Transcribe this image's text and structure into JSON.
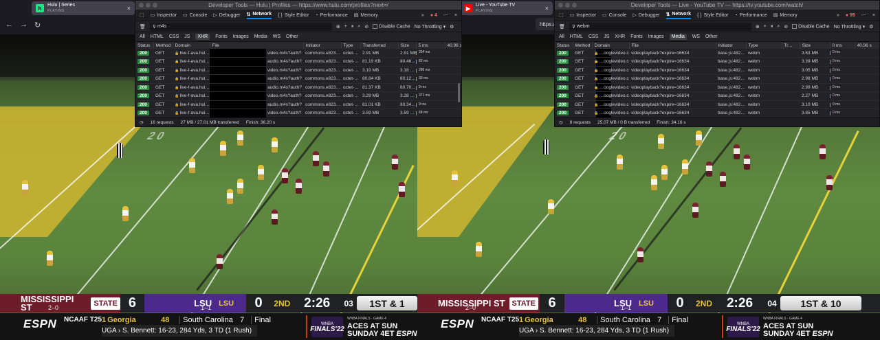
{
  "left": {
    "tab": {
      "title": "Hulu | Series",
      "status": "PLAYING",
      "favicon": "h"
    },
    "devtools": {
      "title": "Developer Tools — Hulu | Profiles — https://www.hulu.com/profiles?next=/",
      "tools": [
        "Inspector",
        "Console",
        "Debugger",
        "Network",
        "Style Editor",
        "Performance",
        "Memory"
      ],
      "error_count": "4",
      "filter_text": "m4s",
      "disable_cache_label": "Disable Cache",
      "throttling_label": "No Throttling",
      "types": [
        "All",
        "HTML",
        "CSS",
        "JS",
        "XHR",
        "Fonts",
        "Images",
        "Media",
        "WS",
        "Other"
      ],
      "active_type": "XHR",
      "columns": [
        "Status",
        "Method",
        "Domain",
        "File",
        "Initiator",
        "Type",
        "Transferred",
        "Size",
        "5 ms",
        "40.96 s"
      ],
      "rows": [
        {
          "status": "200",
          "method": "GET",
          "domain": "live-f-ava.hul…",
          "file": "video.m4s?auth?",
          "initiator": "commons.e823…",
          "type": "octet-…",
          "transferred": "2.91 MB",
          "size": "2.91 MB",
          "wf": "254 ms"
        },
        {
          "status": "200",
          "method": "GET",
          "domain": "live-f-ava.hul…",
          "file": "audio.m4s?auth?",
          "initiator": "commons.e823…",
          "type": "octet-…",
          "transferred": "81.19 KB",
          "size": "80.46…",
          "wf": "82 ms"
        },
        {
          "status": "200",
          "method": "GET",
          "domain": "live-f-ava.hul…",
          "file": "video.m4s?auth?",
          "initiator": "commons.e823…",
          "type": "octet-…",
          "transferred": "3.19 MB",
          "size": "3.18 …",
          "wf": "286 ms"
        },
        {
          "status": "200",
          "method": "GET",
          "domain": "live-f-ava.hul…",
          "file": "audio.m4s?auth?",
          "initiator": "commons.e823…",
          "type": "octet-…",
          "transferred": "80.84 KB",
          "size": "80.12…",
          "wf": "30 ms"
        },
        {
          "status": "200",
          "method": "GET",
          "domain": "live-f-ava.hul…",
          "file": "audio.m4s?auth?",
          "initiator": "commons.e823…",
          "type": "octet-…",
          "transferred": "81.37 KB",
          "size": "80.70…",
          "wf": "9 ms"
        },
        {
          "status": "200",
          "method": "GET",
          "domain": "live-f-ava.hul…",
          "file": "video.m4s?auth?",
          "initiator": "commons.e823…",
          "type": "octet-…",
          "transferred": "3.29 MB",
          "size": "3.28 …",
          "wf": "371 ms"
        },
        {
          "status": "200",
          "method": "GET",
          "domain": "live-f-ava.hul…",
          "file": "audio.m4s?auth?",
          "initiator": "commons.e823…",
          "type": "octet-…",
          "transferred": "81.01 KB",
          "size": "80.34…",
          "wf": "9 ms"
        },
        {
          "status": "200",
          "method": "GET",
          "domain": "live-f-ava.hul…",
          "file": "video.m4s?auth?",
          "initiator": "commons.e823…",
          "type": "octet-…",
          "transferred": "3.59 MB",
          "size": "3.59 …",
          "wf": "68 ms"
        }
      ],
      "footer": {
        "requests": "16 requests",
        "transferred": "27 MB / 27.01 MB transferred",
        "finish": "Finish: 36.20 s"
      }
    },
    "scorebug": {
      "team1": "MISSISSIPPI ST",
      "team1_record": "2–0",
      "team1_logo": "STATE",
      "team1_score": "6",
      "team2": "LSU",
      "team2_record": "1–1",
      "team2_logo": "LSU",
      "team2_score": "0",
      "quarter": "2ND",
      "clock": "2:26",
      "play_clock": "03",
      "down": "1ST & 1"
    }
  },
  "right": {
    "tab": {
      "title": "Live - YouTube TV",
      "status": "PLAYING",
      "favicon": "▶"
    },
    "url": "https://tv.youtube.com/watch",
    "devtools": {
      "title": "Developer Tools — Live - YouTube TV — https://tv.youtube.com/watch/",
      "tools": [
        "Inspector",
        "Console",
        "Debugger",
        "Network",
        "Style Editor",
        "Performance",
        "Memory"
      ],
      "error_count": "95",
      "filter_text": "webm",
      "disable_cache_label": "Disable Cache",
      "throttling_label": "No Throttling",
      "types": [
        "All",
        "HTML",
        "CSS",
        "JS",
        "XHR",
        "Fonts",
        "Images",
        "Media",
        "WS",
        "Other"
      ],
      "active_type": "Media",
      "columns": [
        "Status",
        "Method",
        "Domain",
        "File",
        "Initiator",
        "Type",
        "Tr…",
        "Size",
        "0 ms",
        "40.96 s"
      ],
      "rows": [
        {
          "status": "200",
          "method": "GET",
          "domain": "…ooglevideo.com",
          "file": "videoplayback?expire=16634",
          "initiator": "base.js:482…",
          "type": "webm",
          "transferred": "",
          "size": "3.63 MB",
          "wf": "0 ms"
        },
        {
          "status": "200",
          "method": "GET",
          "domain": "…ooglevideo.com",
          "file": "videoplayback?expire=16634",
          "initiator": "base.js:482…",
          "type": "webm",
          "transferred": "",
          "size": "3.39 MB",
          "wf": "0 ms"
        },
        {
          "status": "200",
          "method": "GET",
          "domain": "…ooglevideo.com",
          "file": "videoplayback?expire=16634",
          "initiator": "base.js:482…",
          "type": "webm",
          "transferred": "",
          "size": "3.05 MB",
          "wf": "0 ms"
        },
        {
          "status": "200",
          "method": "GET",
          "domain": "…ooglevideo.com",
          "file": "videoplayback?expire=16634",
          "initiator": "base.js:482…",
          "type": "webm",
          "transferred": "",
          "size": "2.98 MB",
          "wf": "0 ms"
        },
        {
          "status": "200",
          "method": "GET",
          "domain": "…ooglevideo.com",
          "file": "videoplayback?expire=16634",
          "initiator": "base.js:482…",
          "type": "webm",
          "transferred": "",
          "size": "2.99 MB",
          "wf": "0 ms"
        },
        {
          "status": "200",
          "method": "GET",
          "domain": "…ooglevideo.com",
          "file": "videoplayback?expire=16634",
          "initiator": "base.js:482…",
          "type": "webm",
          "transferred": "",
          "size": "2.27 MB",
          "wf": "0 ms"
        },
        {
          "status": "200",
          "method": "GET",
          "domain": "…ooglevideo.com",
          "file": "videoplayback?expire=16634",
          "initiator": "base.js:482…",
          "type": "webm",
          "transferred": "",
          "size": "3.10 MB",
          "wf": "0 ms"
        },
        {
          "status": "200",
          "method": "GET",
          "domain": "…ooglevideo.com",
          "file": "videoplayback?expire=16634",
          "initiator": "base.js:482…",
          "type": "webm",
          "transferred": "",
          "size": "3.65 MB",
          "wf": "0 ms"
        }
      ],
      "footer": {
        "requests": "8 requests",
        "transferred": "25.07 MB / 0 B transferred",
        "finish": "Finish: 34.16 s"
      }
    },
    "scorebug": {
      "team1": "MISSISSIPPI ST",
      "team1_record": "2–0",
      "team1_logo": "STATE",
      "team1_score": "6",
      "team2": "LSU",
      "team2_record": "1–1",
      "team2_logo": "LSU",
      "team2_score": "0",
      "quarter": "2ND",
      "clock": "2:26",
      "play_clock": "04",
      "down": "1ST & 10"
    }
  },
  "ticker": {
    "network": "ESPN",
    "league": "NCAAF T25",
    "rank": "1",
    "team_a": "Georgia",
    "score_a": "48",
    "team_b": "South Carolina",
    "score_b": "7",
    "status": "Final",
    "detail": "UGA  ›  S. Bennett: 16-23, 284 Yds, 3 TD (1 Rush)",
    "promo_badge_top": "WNBA",
    "promo_badge_main": "FINALS'22",
    "promo_sub": "WNBA FINALS · GAME 4",
    "promo_line1": "ACES AT SUN",
    "promo_line2": "SUNDAY 4ET",
    "promo_network": "ESPN"
  },
  "field": {
    "number_left": "2 0",
    "number_right": "2 0"
  },
  "colors": {
    "lsu_purple": "#4b2a8c",
    "msu_maroon": "#6e1b2a",
    "field_green": "#5a833c",
    "accent_blue": "#0a84ff",
    "status_green": "#2b8a3e"
  }
}
